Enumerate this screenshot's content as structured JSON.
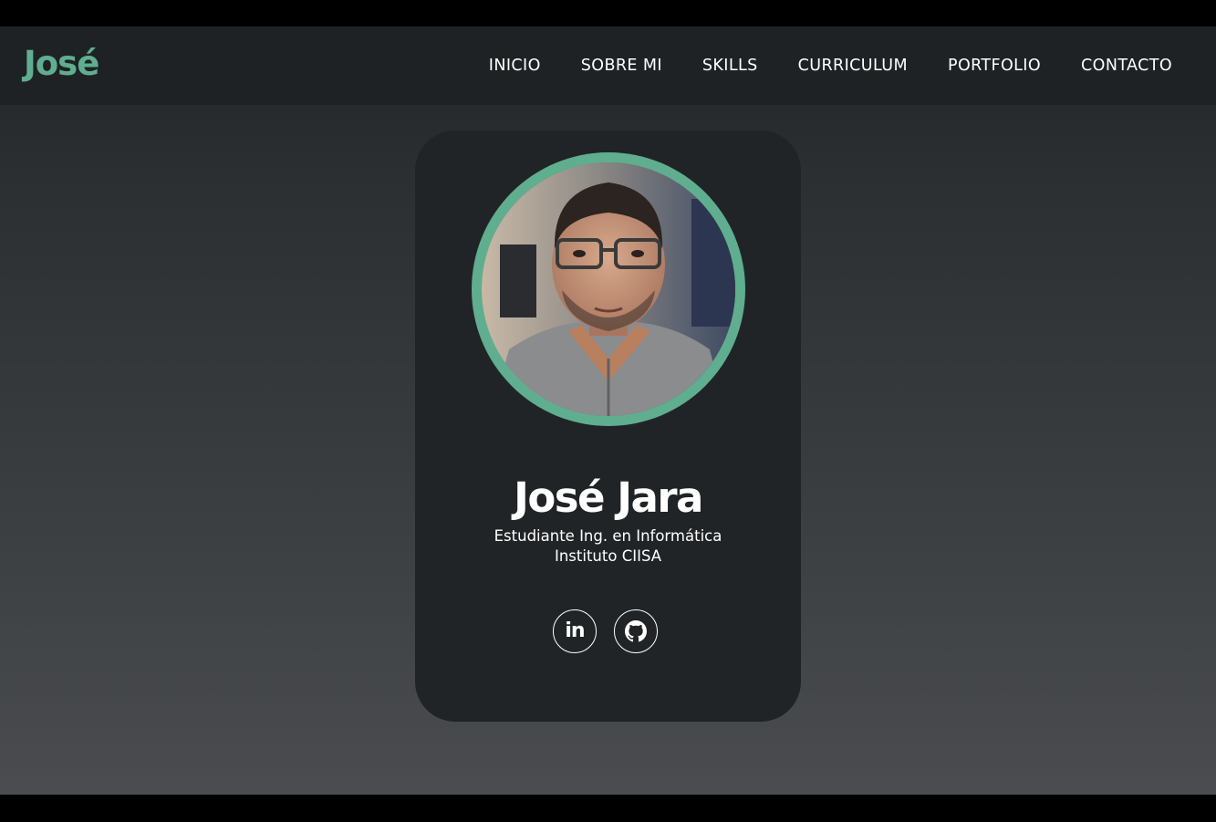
{
  "brand": {
    "logo_text": "José",
    "accent_color": "#5fae8f"
  },
  "nav": {
    "items": [
      {
        "label": "INICIO"
      },
      {
        "label": "SOBRE MI"
      },
      {
        "label": "SKILLS"
      },
      {
        "label": "CURRICULUM"
      },
      {
        "label": "PORTFOLIO"
      },
      {
        "label": "CONTACTO"
      }
    ]
  },
  "profile": {
    "name": "José Jara",
    "subtitle_line1": "Estudiante Ing. en Informática",
    "subtitle_line2": "Instituto CIISA",
    "photo_icon": "profile-photo",
    "linkedin_glyph": "in",
    "socials": [
      {
        "icon": "linkedin-icon"
      },
      {
        "icon": "github-icon"
      }
    ]
  },
  "colors": {
    "navbar_bg": "#1f2224",
    "card_bg": "#212426",
    "text": "#ffffff"
  }
}
